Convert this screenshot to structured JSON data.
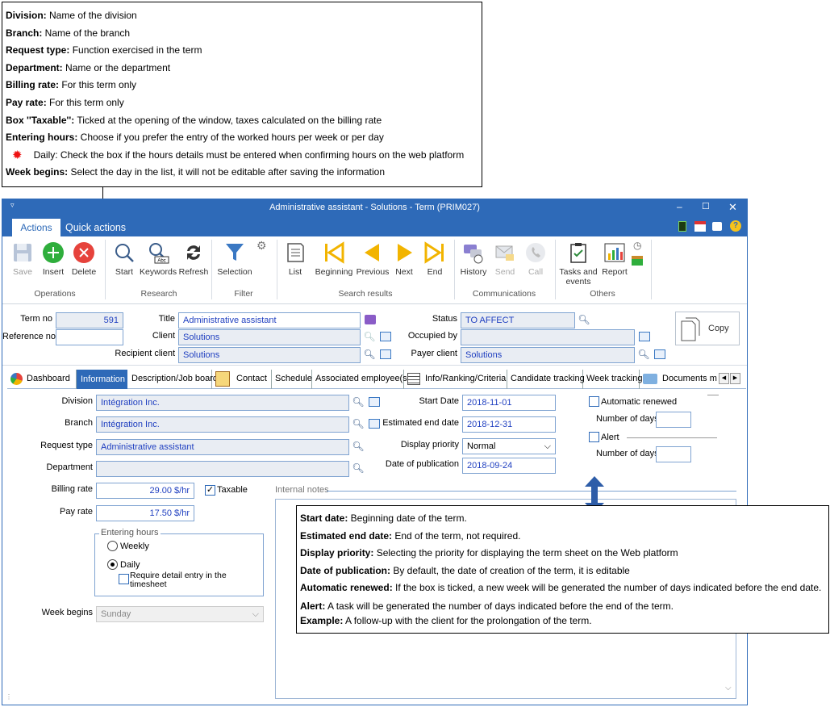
{
  "note_top": [
    {
      "term": "Division:",
      "text": " Name of the division"
    },
    {
      "term": "Branch:",
      "text": " Name of the branch"
    },
    {
      "term": "Request type:",
      "text": " Function exercised in the term"
    },
    {
      "term": "Department:",
      "text": " Name or the department"
    },
    {
      "term": "Billing rate:",
      "text": " For this term only"
    },
    {
      "term": "Pay rate:",
      "text": " For this term only"
    },
    {
      "term": "Box ''Taxable'':",
      "text": " Ticked at the opening of the window, taxes calculated on the billing rate"
    },
    {
      "term": "Entering hours:",
      "text": " Choose if you prefer the entry of the worked hours per week or per day"
    },
    {
      "term": "",
      "text": "Daily: Check the box if the hours details must be entered when confirming hours on the web platform"
    },
    {
      "term": "Week begins:",
      "text": " Select the day in the list, it will not be editable after saving the information"
    }
  ],
  "note_bottom": [
    {
      "term": "Start date:",
      "text": " Beginning date of the term."
    },
    {
      "term": "Estimated end date:",
      "text": " End of the term, not required."
    },
    {
      "term": "Display priority:",
      "text": " Selecting the priority for displaying the term sheet on the Web platform"
    },
    {
      "term": "Date of publication:",
      "text": " By default, the date of creation of the term, it is editable"
    },
    {
      "term": "Automatic renewed:",
      "text": " If the box is ticked, a new week will be generated the number of days indicated before the end date."
    },
    {
      "term": "Alert:",
      "text": " A task will be generated the number of days indicated before the end of the term."
    },
    {
      "term": "Example:",
      "text": " A follow-up with the client for the prolongation of the term."
    }
  ],
  "window": {
    "title": "Administrative assistant - Solutions - Term (PRIM027)",
    "tab_actions": "Actions",
    "tab_quick": "Quick actions"
  },
  "ribbon": {
    "buttons": {
      "save": "Save",
      "insert": "Insert",
      "delete": "Delete",
      "start": "Start",
      "keywords": "Keywords",
      "refresh": "Refresh",
      "selection": "Selection",
      "list": "List",
      "beginning": "Beginning",
      "previous": "Previous",
      "next": "Next",
      "end": "End",
      "history": "History",
      "send": "Send",
      "call": "Call",
      "tasks": "Tasks and",
      "tasks2": "events",
      "report": "Report"
    },
    "groups": {
      "operations": "Operations",
      "research": "Research",
      "filter": "Filter",
      "search_results": "Search results",
      "communications": "Communications",
      "others": "Others"
    }
  },
  "header": {
    "term_no_label": "Term no",
    "term_no": "591",
    "reference_label": "Reference no",
    "reference": "",
    "title_label": "Title",
    "title": "Administrative assistant",
    "client_label": "Client",
    "client": "Solutions",
    "recipient_label": "Recipient client",
    "recipient": "Solutions",
    "status_label": "Status",
    "status": "TO AFFECT",
    "occupied_label": "Occupied by",
    "occupied": "",
    "payer_label": "Payer client",
    "payer": "Solutions",
    "copy": "Copy"
  },
  "tabs": [
    "Dashboard",
    "Information",
    "Description/Job board",
    "Contact",
    "Schedule",
    "Associated employee(s)",
    "Info/Ranking/Criteria",
    "Candidate tracking",
    "Week tracking",
    "Documents mar"
  ],
  "info": {
    "division_label": "Division",
    "division": "Intégration Inc.",
    "branch_label": "Branch",
    "branch": "Intégration Inc.",
    "request_label": "Request type",
    "request": "Administrative assistant",
    "department_label": "Department",
    "department": "",
    "billing_label": "Billing rate",
    "billing": "29.00 $/hr",
    "taxable_label": "Taxable",
    "pay_label": "Pay rate",
    "pay": "17.50 $/hr",
    "entering_hours_label": "Entering hours",
    "weekly": "Weekly",
    "daily": "Daily",
    "require_detail": "Require detail entry in the",
    "require_detail2": "timesheet",
    "week_begins_label": "Week begins",
    "week_begins": "Sunday",
    "start_label": "Start Date",
    "start": "2018-11-01",
    "end_label": "Estimated end date",
    "end": "2018-12-31",
    "priority_label": "Display priority",
    "priority": "Normal",
    "publication_label": "Date of publication",
    "publication": "2018-09-24",
    "auto_renewed_label": "Automatic renewed",
    "num_days_label": "Number of days",
    "alert_label": "Alert",
    "num_days_label2": "Number of days",
    "internal_notes": "Internal notes"
  },
  "colors": {
    "accent": "#2e6ab8",
    "field_border": "#7fa3d1",
    "value_text": "#1f3fc0"
  }
}
